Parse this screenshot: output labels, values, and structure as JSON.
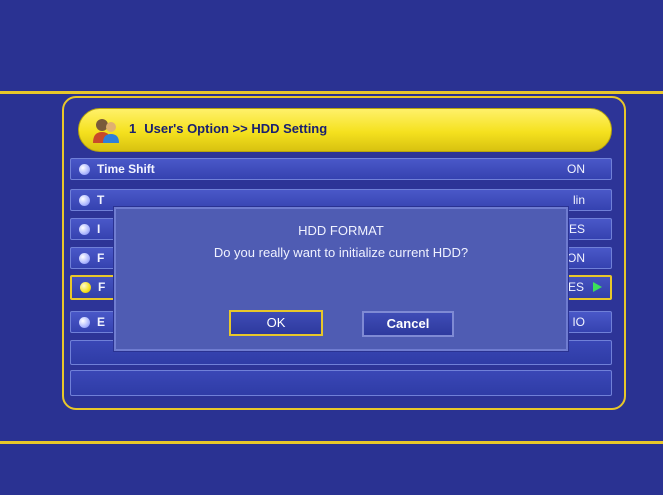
{
  "header": {
    "number": "1",
    "breadcrumb": "User's Option >> HDD Setting",
    "icon": "users-icon"
  },
  "rows": [
    {
      "label": "Time Shift",
      "value": "ON"
    },
    {
      "label": "T",
      "value": "lin"
    },
    {
      "label": "I",
      "value": "ES"
    },
    {
      "label": "F",
      "value": "ON"
    },
    {
      "label": "F",
      "value": "ES"
    },
    {
      "label": "E",
      "value": "IO"
    }
  ],
  "dialog": {
    "title": "HDD FORMAT",
    "message": "Do you really want to initialize current HDD?",
    "ok_label": "OK",
    "cancel_label": "Cancel"
  },
  "colors": {
    "background": "#2a3292",
    "accent": "#e8c72a",
    "dialog": "#4f5cb3",
    "arrow": "#3be05a"
  }
}
